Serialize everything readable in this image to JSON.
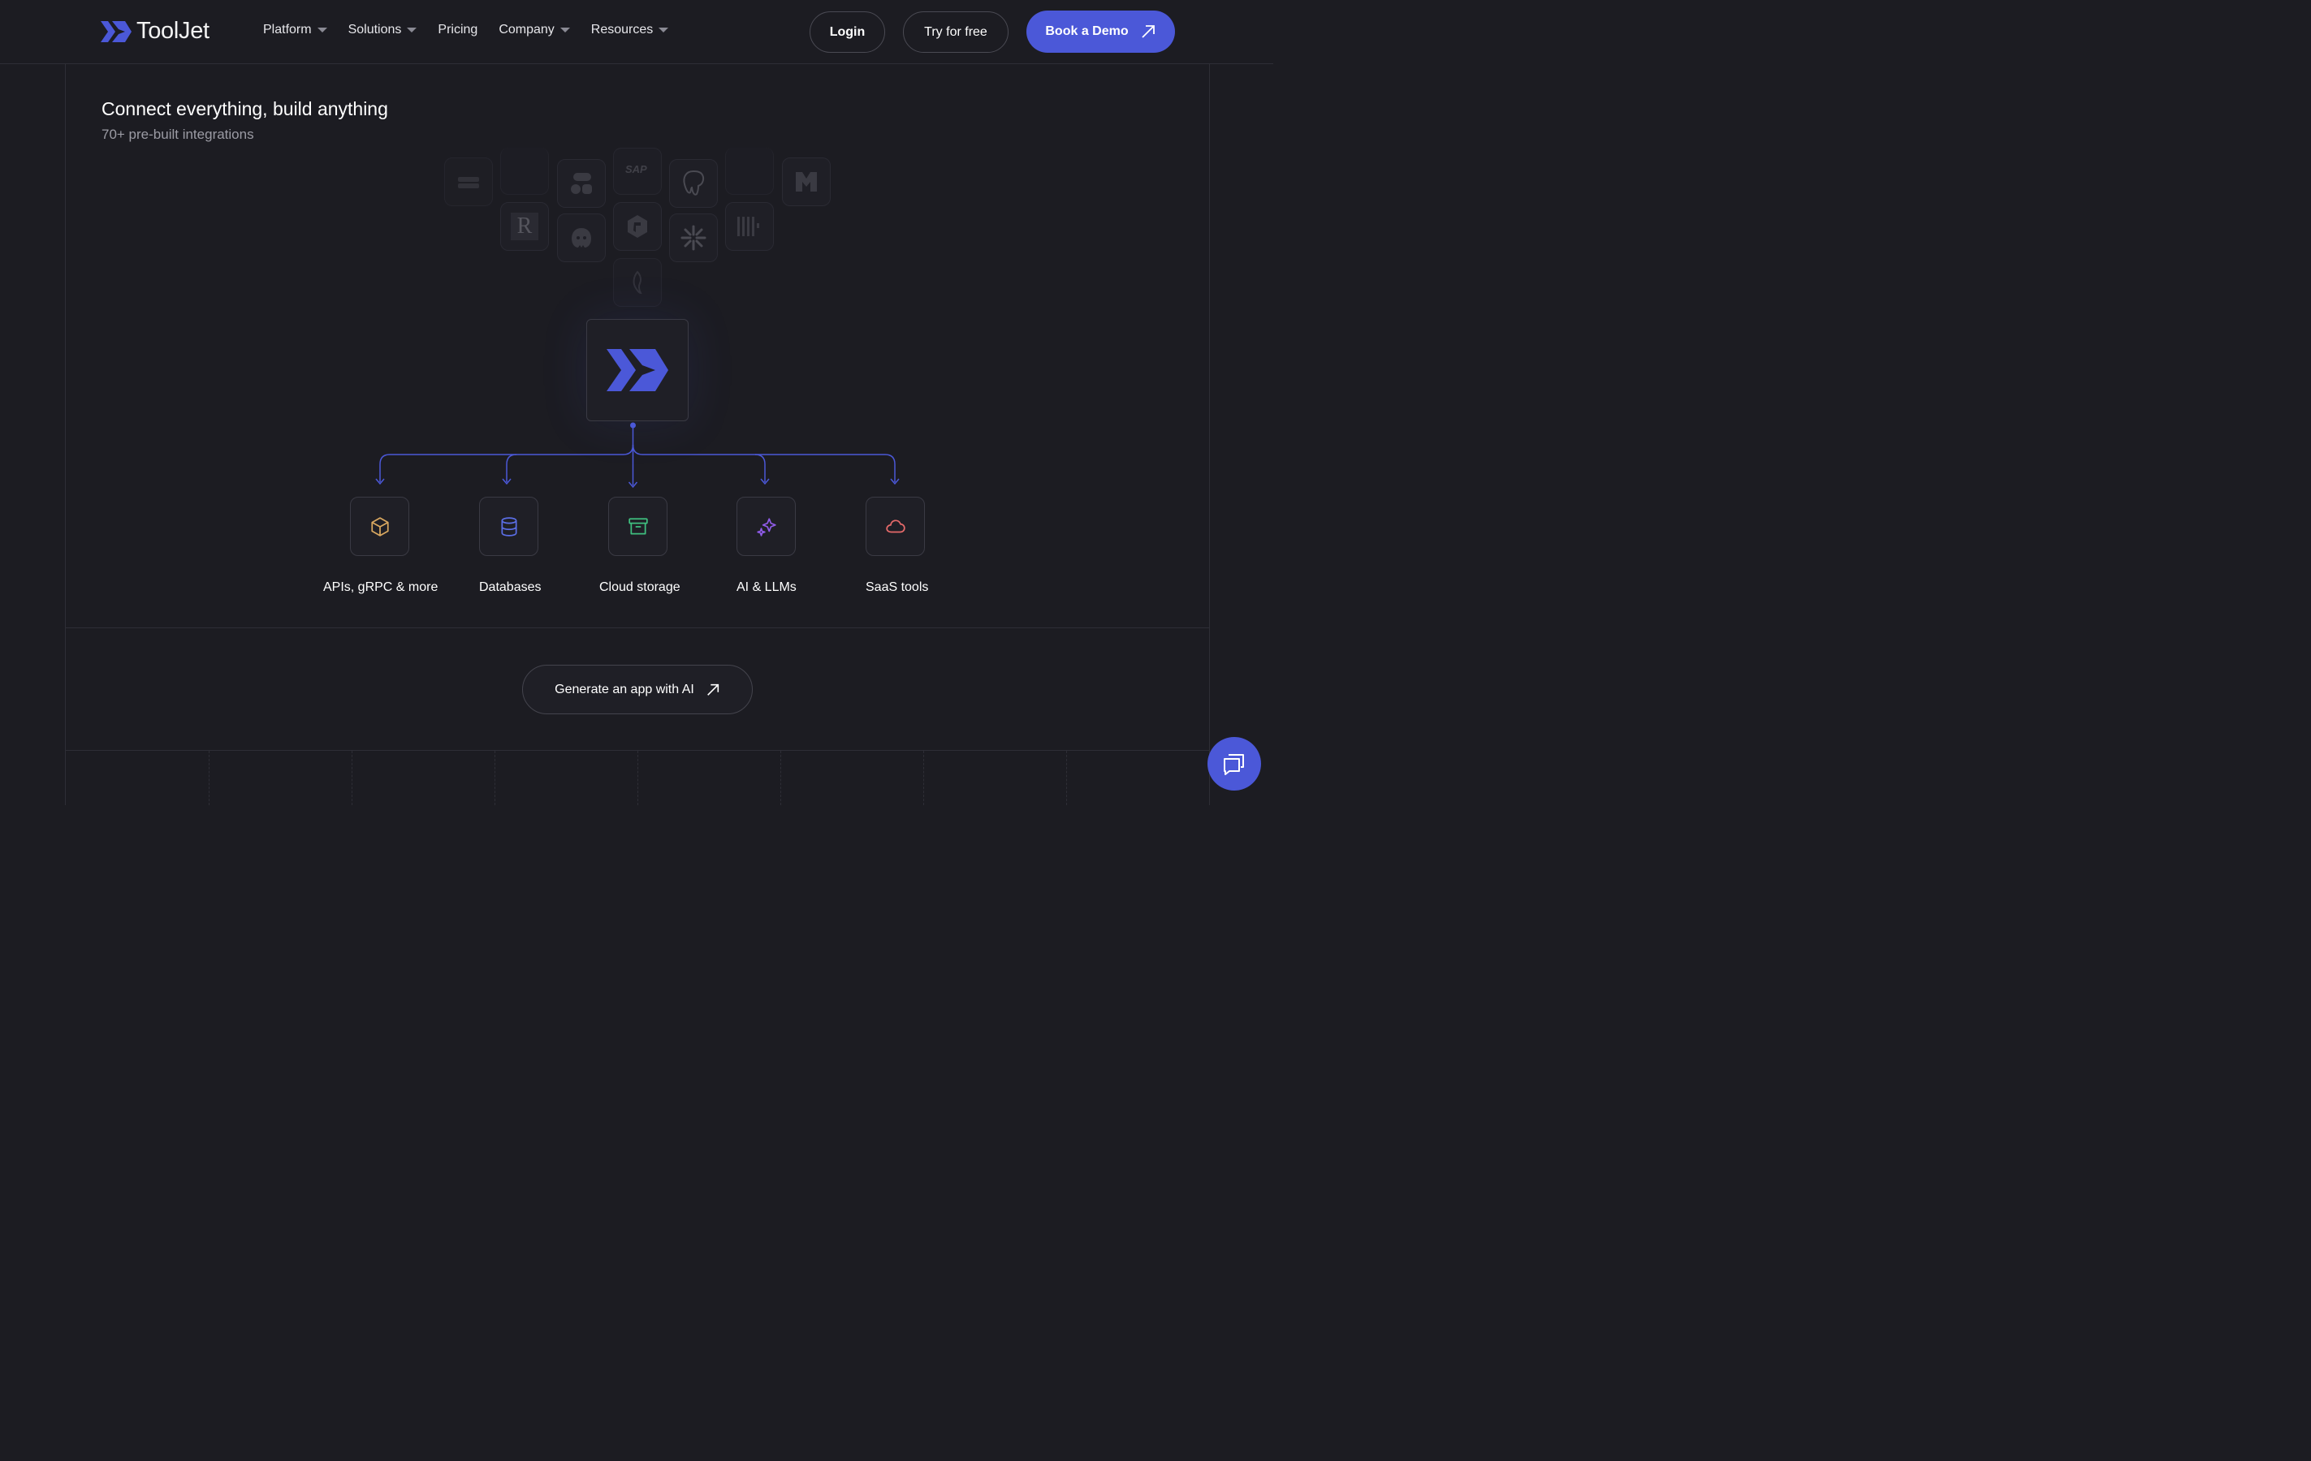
{
  "header": {
    "logo_text": "ToolJet",
    "nav": [
      {
        "label": "Platform",
        "dropdown": true
      },
      {
        "label": "Solutions",
        "dropdown": true
      },
      {
        "label": "Pricing",
        "dropdown": false
      },
      {
        "label": "Company",
        "dropdown": true
      },
      {
        "label": "Resources",
        "dropdown": true
      }
    ],
    "login_label": "Login",
    "try_label": "Try for free",
    "demo_label": "Book a Demo"
  },
  "section": {
    "title": "Connect everything, build anything",
    "subtitle": "70+ pre-built integrations"
  },
  "integrations": {
    "icons": [
      "couchdb-icon",
      "blank-icon",
      "airtable-icon",
      "sap-icon",
      "postgresql-icon",
      "blank-icon",
      "minio-icon",
      "r-icon",
      "hugging-face-icon",
      "graphql-icon",
      "snowflake-icon",
      "barcode-icon",
      "mysql-icon"
    ],
    "sap_text": "SAP",
    "r_text": "R"
  },
  "categories": [
    {
      "label": "APIs, gRPC & more",
      "icon": "cube-icon",
      "color": "#d9a860"
    },
    {
      "label": "Databases",
      "icon": "database-icon",
      "color": "#5b6ee6"
    },
    {
      "label": "Cloud storage",
      "icon": "archive-icon",
      "color": "#3fbf7f"
    },
    {
      "label": "AI & LLMs",
      "icon": "sparkle-icon",
      "color": "#8e5be6"
    },
    {
      "label": "SaaS tools",
      "icon": "cloud-icon",
      "color": "#e66a6a"
    }
  ],
  "cta": {
    "label": "Generate an app with AI"
  },
  "colors": {
    "accent": "#4b58d8",
    "background": "#1c1c22"
  }
}
